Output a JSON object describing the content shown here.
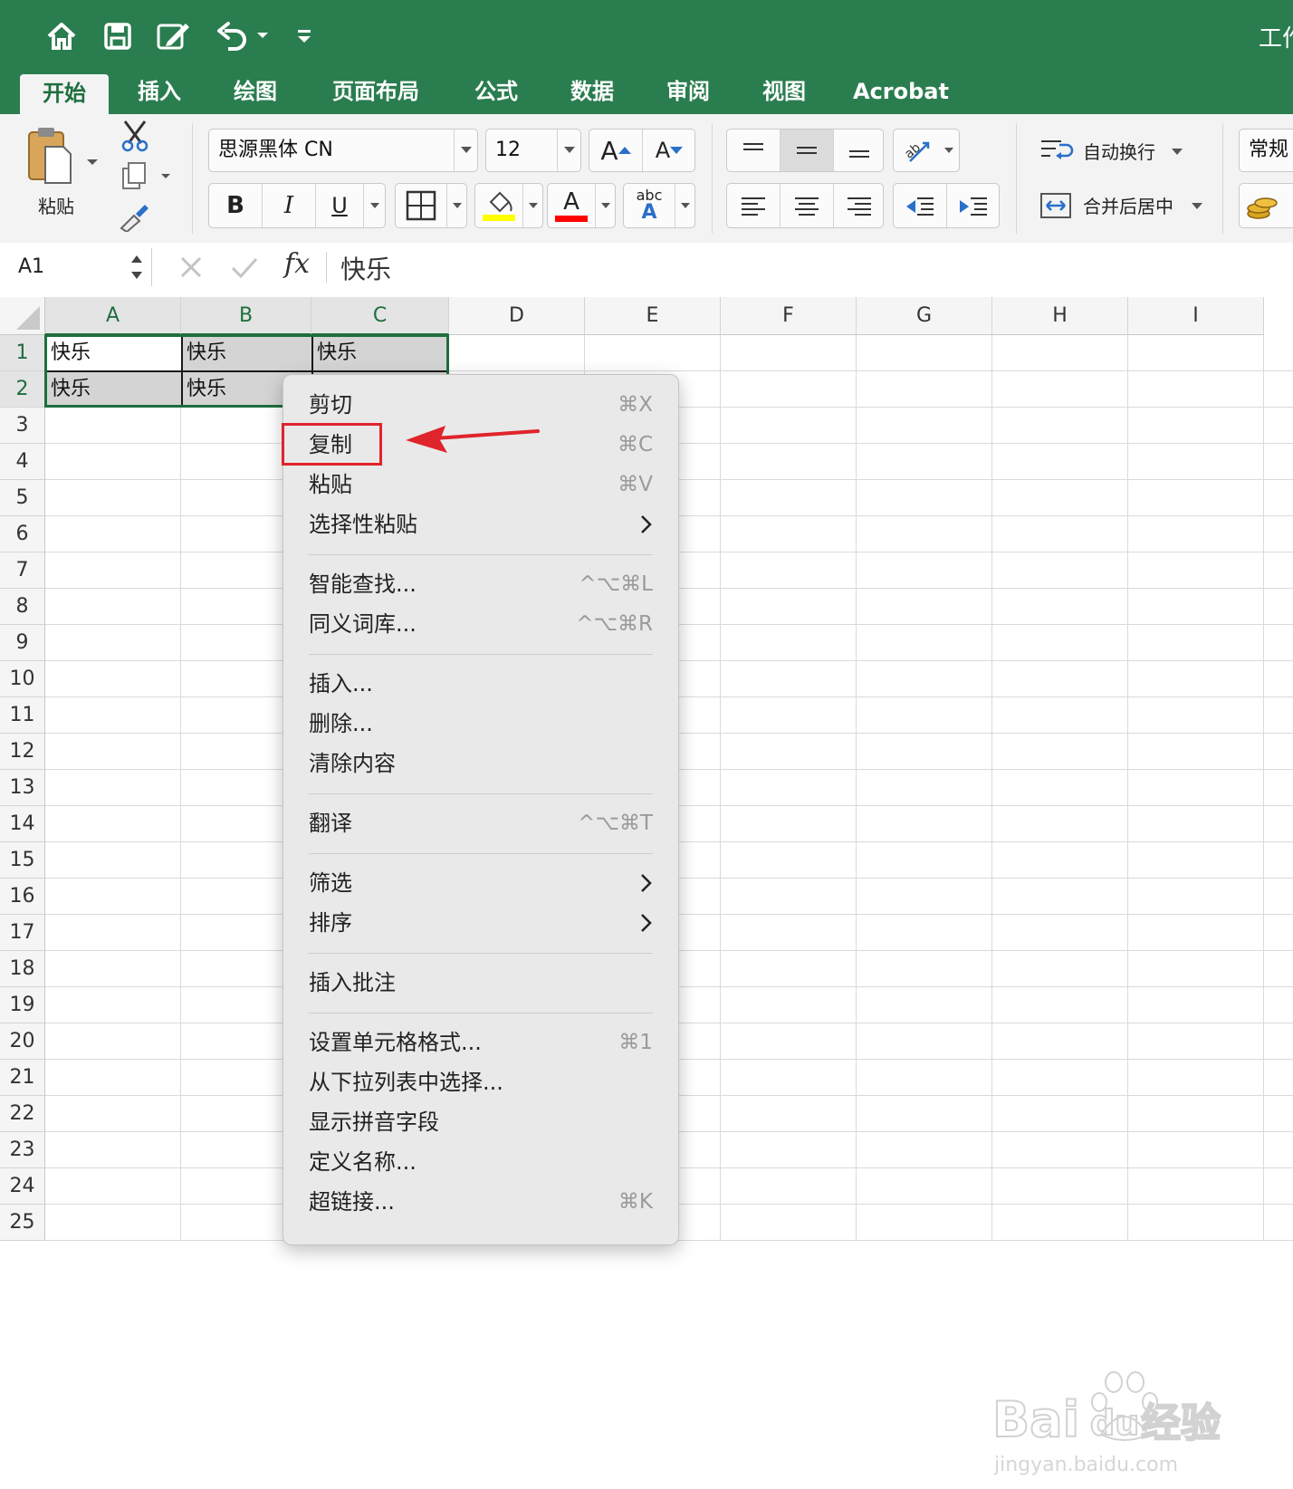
{
  "window": {
    "title": "工作"
  },
  "quick_access": {
    "home": "home-icon",
    "save": "save-icon",
    "edit": "edit-icon",
    "undo": "undo-icon",
    "customize": "customize-icon"
  },
  "tabs": [
    "开始",
    "插入",
    "绘图",
    "页面布局",
    "公式",
    "数据",
    "审阅",
    "视图",
    "Acrobat"
  ],
  "active_tab": "开始",
  "ribbon": {
    "paste_label": "粘贴",
    "font_name": "思源黑体 CN",
    "font_size": "12",
    "grow_font": "A",
    "shrink_font": "A",
    "bold": "B",
    "italic": "I",
    "underline": "U",
    "font_color_letter": "A",
    "orientation_letters": "abc",
    "wrap_text": "自动换行",
    "merge_center": "合并后居中",
    "number_format": "常规",
    "fill_color": "#ffff00",
    "font_color": "#ff0000"
  },
  "formula_bar": {
    "name_box": "A1",
    "fx": "fx",
    "content": "快乐"
  },
  "sheet": {
    "columns": [
      "A",
      "B",
      "C",
      "D",
      "E",
      "F",
      "G",
      "H",
      "I"
    ],
    "rows": [
      "1",
      "2",
      "3",
      "4",
      "5",
      "6",
      "7",
      "8",
      "9",
      "10",
      "11",
      "12",
      "13",
      "14",
      "15",
      "16",
      "17",
      "18",
      "19",
      "20",
      "21",
      "22",
      "23",
      "24",
      "25"
    ],
    "cells": {
      "A1": "快乐",
      "B1": "快乐",
      "C1": "快乐",
      "A2": "快乐",
      "B2": "快乐"
    },
    "selection": "A1:C2",
    "selection_color": "#1e6e3e"
  },
  "context_menu": {
    "items": [
      {
        "label": "剪切",
        "shortcut": "⌘X"
      },
      {
        "label": "复制",
        "shortcut": "⌘C"
      },
      {
        "label": "粘贴",
        "shortcut": "⌘V"
      },
      {
        "label": "选择性粘贴",
        "submenu": true
      },
      {
        "label": "智能查找...",
        "shortcut": "^⌥⌘L"
      },
      {
        "label": "同义词库...",
        "shortcut": "^⌥⌘R"
      },
      {
        "label": "插入..."
      },
      {
        "label": "删除..."
      },
      {
        "label": "清除内容"
      },
      {
        "label": "翻译",
        "shortcut": "^⌥⌘T"
      },
      {
        "label": "筛选",
        "submenu": true
      },
      {
        "label": "排序",
        "submenu": true
      },
      {
        "label": "插入批注"
      },
      {
        "label": "设置单元格格式...",
        "shortcut": "⌘1"
      },
      {
        "label": "从下拉列表中选择..."
      },
      {
        "label": "显示拼音字段"
      },
      {
        "label": "定义名称..."
      },
      {
        "label": "超链接...",
        "shortcut": "⌘K"
      }
    ],
    "highlighted": "复制",
    "annotation_color": "#e0242c"
  },
  "watermark": {
    "line1": "Bai",
    "line2": "du",
    "line3": "经验",
    "url": "jingyan.baidu.com"
  }
}
